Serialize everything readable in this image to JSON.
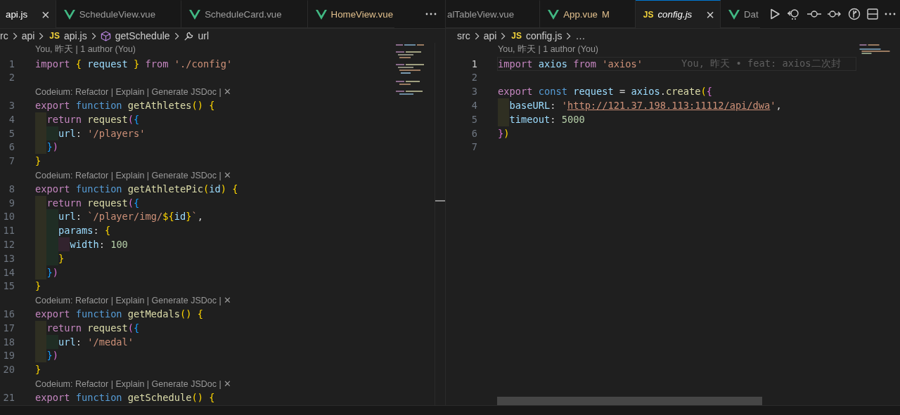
{
  "groups": [
    {
      "focused": false,
      "tabs": [
        {
          "label": "api.js",
          "kind": "none",
          "selected": true,
          "italic": false,
          "modified": false,
          "close": "×"
        },
        {
          "label": "ScheduleView.vue",
          "kind": "vue",
          "selected": false,
          "italic": false,
          "modified": false
        },
        {
          "label": "ScheduleCard.vue",
          "kind": "vue",
          "selected": false,
          "italic": false,
          "modified": false
        },
        {
          "label": "HomeView.vue",
          "kind": "vue",
          "selected": false,
          "italic": false,
          "modified": true
        }
      ],
      "breadcrumbs": [
        {
          "label": "rc",
          "kind": "folder"
        },
        {
          "label": "api",
          "kind": "folder"
        },
        {
          "label": "api.js",
          "kind": "js",
          "icon_text": "JS"
        },
        {
          "label": "getSchedule",
          "kind": "function"
        },
        {
          "label": "url",
          "kind": "property"
        }
      ],
      "rows": [
        {
          "kind": "lens",
          "text": "You, 昨天 | 1 author (You)"
        },
        {
          "kind": "code",
          "number": "1",
          "current": false,
          "tokens": [
            {
              "text": "import ",
              "kind": "kw"
            },
            {
              "text": "{ ",
              "kind": "b1"
            },
            {
              "text": "request ",
              "kind": "var"
            },
            {
              "text": "} ",
              "kind": "b1"
            },
            {
              "text": "from ",
              "kind": "kw"
            },
            {
              "text": "'./config'",
              "kind": "str"
            }
          ]
        },
        {
          "kind": "code",
          "number": "2",
          "current": false,
          "tokens": []
        },
        {
          "kind": "lens",
          "text": "Codeium: Refactor | Explain | Generate JSDoc | ✕"
        },
        {
          "kind": "code",
          "number": "3",
          "current": false,
          "tokens": [
            {
              "text": "export ",
              "kind": "kw"
            },
            {
              "text": "function ",
              "kind": "st"
            },
            {
              "text": "getAthletes",
              "kind": "fn"
            },
            {
              "text": "() {",
              "kind": "b1"
            }
          ]
        },
        {
          "kind": "code",
          "number": "4",
          "current": false,
          "tokens": [
            {
              "text": "  return ",
              "kind": "kw"
            },
            {
              "text": "request",
              "kind": "fn"
            },
            {
              "text": "(",
              "kind": "b2"
            },
            {
              "text": "{",
              "kind": "b3"
            }
          ]
        },
        {
          "kind": "code",
          "number": "5",
          "current": false,
          "tokens": [
            {
              "text": "    url",
              "kind": "var"
            },
            {
              "text": ": ",
              "kind": "p"
            },
            {
              "text": "'/players'",
              "kind": "str"
            }
          ]
        },
        {
          "kind": "code",
          "number": "6",
          "current": false,
          "tokens": [
            {
              "text": "  }",
              "kind": "b3"
            },
            {
              "text": ")",
              "kind": "b2"
            }
          ]
        },
        {
          "kind": "code",
          "number": "7",
          "current": false,
          "tokens": [
            {
              "text": "}",
              "kind": "b1"
            }
          ]
        },
        {
          "kind": "lens",
          "text": "Codeium: Refactor | Explain | Generate JSDoc | ✕"
        },
        {
          "kind": "code",
          "number": "8",
          "current": false,
          "tokens": [
            {
              "text": "export ",
              "kind": "kw"
            },
            {
              "text": "function ",
              "kind": "st"
            },
            {
              "text": "getAthletePic",
              "kind": "fn"
            },
            {
              "text": "(",
              "kind": "b1"
            },
            {
              "text": "id",
              "kind": "var"
            },
            {
              "text": ") {",
              "kind": "b1"
            }
          ]
        },
        {
          "kind": "code",
          "number": "9",
          "current": false,
          "tokens": [
            {
              "text": "  return ",
              "kind": "kw"
            },
            {
              "text": "request",
              "kind": "fn"
            },
            {
              "text": "(",
              "kind": "b2"
            },
            {
              "text": "{",
              "kind": "b3"
            }
          ]
        },
        {
          "kind": "code",
          "number": "10",
          "current": false,
          "tokens": [
            {
              "text": "    url",
              "kind": "var"
            },
            {
              "text": ": ",
              "kind": "p"
            },
            {
              "text": "`/player/img/",
              "kind": "str"
            },
            {
              "text": "${",
              "kind": "b1"
            },
            {
              "text": "id",
              "kind": "var"
            },
            {
              "text": "}",
              "kind": "b1"
            },
            {
              "text": "`",
              "kind": "str"
            },
            {
              "text": ",",
              "kind": "p"
            }
          ]
        },
        {
          "kind": "code",
          "number": "11",
          "current": false,
          "tokens": [
            {
              "text": "    params",
              "kind": "var"
            },
            {
              "text": ": ",
              "kind": "p"
            },
            {
              "text": "{",
              "kind": "b1"
            }
          ]
        },
        {
          "kind": "code",
          "number": "12",
          "current": false,
          "tokens": [
            {
              "text": "      width",
              "kind": "var"
            },
            {
              "text": ": ",
              "kind": "p"
            },
            {
              "text": "100",
              "kind": "num"
            }
          ]
        },
        {
          "kind": "code",
          "number": "13",
          "current": false,
          "tokens": [
            {
              "text": "    }",
              "kind": "b1"
            }
          ]
        },
        {
          "kind": "code",
          "number": "14",
          "current": false,
          "tokens": [
            {
              "text": "  }",
              "kind": "b3"
            },
            {
              "text": ")",
              "kind": "b2"
            }
          ]
        },
        {
          "kind": "code",
          "number": "15",
          "current": false,
          "tokens": [
            {
              "text": "}",
              "kind": "b1"
            }
          ]
        },
        {
          "kind": "lens",
          "text": "Codeium: Refactor | Explain | Generate JSDoc | ✕"
        },
        {
          "kind": "code",
          "number": "16",
          "current": false,
          "tokens": [
            {
              "text": "export ",
              "kind": "kw"
            },
            {
              "text": "function ",
              "kind": "st"
            },
            {
              "text": "getMedals",
              "kind": "fn"
            },
            {
              "text": "() {",
              "kind": "b1"
            }
          ]
        },
        {
          "kind": "code",
          "number": "17",
          "current": false,
          "tokens": [
            {
              "text": "  return ",
              "kind": "kw"
            },
            {
              "text": "request",
              "kind": "fn"
            },
            {
              "text": "(",
              "kind": "b2"
            },
            {
              "text": "{",
              "kind": "b3"
            }
          ]
        },
        {
          "kind": "code",
          "number": "18",
          "current": false,
          "tokens": [
            {
              "text": "    url",
              "kind": "var"
            },
            {
              "text": ": ",
              "kind": "p"
            },
            {
              "text": "'/medal'",
              "kind": "str"
            }
          ]
        },
        {
          "kind": "code",
          "number": "19",
          "current": false,
          "tokens": [
            {
              "text": "  }",
              "kind": "b3"
            },
            {
              "text": ")",
              "kind": "b2"
            }
          ]
        },
        {
          "kind": "code",
          "number": "20",
          "current": false,
          "tokens": [
            {
              "text": "}",
              "kind": "b1"
            }
          ]
        },
        {
          "kind": "lens",
          "text": "Codeium: Refactor | Explain | Generate JSDoc | ✕"
        },
        {
          "kind": "code",
          "number": "21",
          "current": false,
          "tokens": [
            {
              "text": "export ",
              "kind": "kw"
            },
            {
              "text": "function ",
              "kind": "st"
            },
            {
              "text": "getSchedule",
              "kind": "fn"
            },
            {
              "text": "() {",
              "kind": "b1"
            }
          ]
        }
      ]
    },
    {
      "focused": true,
      "tabs": [
        {
          "label": "alTableView.vue",
          "kind": "none",
          "selected": false,
          "italic": false,
          "modified": false
        },
        {
          "label": "App.vue",
          "kind": "vue",
          "selected": false,
          "italic": false,
          "modified": true,
          "status": "M"
        },
        {
          "label": "config.js",
          "kind": "js",
          "icon_text": "JS",
          "selected": true,
          "italic": true,
          "modified": false,
          "close": "×"
        },
        {
          "label": "Dat",
          "kind": "vue",
          "selected": false,
          "italic": false,
          "modified": false
        }
      ],
      "breadcrumbs": [
        {
          "label": "src",
          "kind": "folder"
        },
        {
          "label": "api",
          "kind": "folder"
        },
        {
          "label": "config.js",
          "kind": "js",
          "icon_text": "JS"
        },
        {
          "label": "…",
          "kind": "more"
        }
      ],
      "rows": [
        {
          "kind": "lens",
          "text": "You, 昨天 | 1 author (You)"
        },
        {
          "kind": "code",
          "number": "1",
          "current": true,
          "tokens": [
            {
              "text": "import ",
              "kind": "kw"
            },
            {
              "text": "axios ",
              "kind": "var"
            },
            {
              "text": "from ",
              "kind": "kw"
            },
            {
              "text": "'axios'",
              "kind": "str"
            }
          ],
          "blame": "You, 昨天 • feat: axios二次封"
        },
        {
          "kind": "code",
          "number": "2",
          "current": false,
          "tokens": []
        },
        {
          "kind": "code",
          "number": "3",
          "current": false,
          "tokens": [
            {
              "text": "export ",
              "kind": "kw"
            },
            {
              "text": "const ",
              "kind": "st"
            },
            {
              "text": "request ",
              "kind": "var"
            },
            {
              "text": "= ",
              "kind": "p"
            },
            {
              "text": "axios",
              "kind": "var"
            },
            {
              "text": ".",
              "kind": "p"
            },
            {
              "text": "create",
              "kind": "fn"
            },
            {
              "text": "(",
              "kind": "b1"
            },
            {
              "text": "{",
              "kind": "b2"
            }
          ]
        },
        {
          "kind": "code",
          "number": "4",
          "current": false,
          "tokens": [
            {
              "text": "  baseURL",
              "kind": "var"
            },
            {
              "text": ": ",
              "kind": "p"
            },
            {
              "text": "'",
              "kind": "str"
            },
            {
              "text": "http://121.37.198.113:11112/api/dwa",
              "kind": "url"
            },
            {
              "text": "'",
              "kind": "str"
            },
            {
              "text": ",",
              "kind": "p"
            }
          ]
        },
        {
          "kind": "code",
          "number": "5",
          "current": false,
          "tokens": [
            {
              "text": "  timeout",
              "kind": "var"
            },
            {
              "text": ": ",
              "kind": "p"
            },
            {
              "text": "5000",
              "kind": "num"
            }
          ]
        },
        {
          "kind": "code",
          "number": "6",
          "current": false,
          "tokens": [
            {
              "text": "}",
              "kind": "b2"
            },
            {
              "text": ")",
              "kind": "b1"
            }
          ]
        },
        {
          "kind": "code",
          "number": "7",
          "current": false,
          "tokens": []
        }
      ]
    }
  ]
}
